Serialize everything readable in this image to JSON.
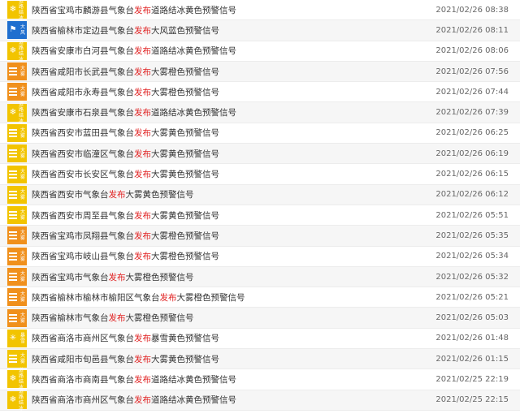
{
  "colors": {
    "yellow": "#f2c400",
    "orange": "#f0901c",
    "blue": "#1f6fcf",
    "highlight": "#e02020"
  },
  "items": [
    {
      "pre": "陕西省宝鸡市麟游县气象台",
      "hl": "发布",
      "post": "道路结冰黄色预警信号",
      "time": "2021/02/26 08:38",
      "icon": "road-icing-icon",
      "color": "yellow",
      "label": [
        "道路",
        "结冰"
      ]
    },
    {
      "pre": "陕西省榆林市定边县气象台",
      "hl": "发布",
      "post": "大风蓝色预警信号",
      "time": "2021/02/26 08:11",
      "icon": "gale-icon",
      "color": "blue",
      "label": [
        "大",
        "风"
      ]
    },
    {
      "pre": "陕西省安康市白河县气象台",
      "hl": "发布",
      "post": "道路结冰黄色预警信号",
      "time": "2021/02/26 08:06",
      "icon": "road-icing-icon",
      "color": "yellow",
      "label": [
        "道路",
        "结冰"
      ]
    },
    {
      "pre": "陕西省咸阳市长武县气象台",
      "hl": "发布",
      "post": "大雾橙色预警信号",
      "time": "2021/02/26 07:56",
      "icon": "fog-icon",
      "color": "orange",
      "label": [
        "大",
        "雾"
      ]
    },
    {
      "pre": "陕西省咸阳市永寿县气象台",
      "hl": "发布",
      "post": "大雾橙色预警信号",
      "time": "2021/02/26 07:44",
      "icon": "fog-icon",
      "color": "orange",
      "label": [
        "大",
        "雾"
      ]
    },
    {
      "pre": "陕西省安康市石泉县气象台",
      "hl": "发布",
      "post": "道路结冰黄色预警信号",
      "time": "2021/02/26 07:39",
      "icon": "road-icing-icon",
      "color": "yellow",
      "label": [
        "道路",
        "结冰"
      ]
    },
    {
      "pre": "陕西省西安市蓝田县气象台",
      "hl": "发布",
      "post": "大雾黄色预警信号",
      "time": "2021/02/26 06:25",
      "icon": "fog-icon",
      "color": "yellow",
      "label": [
        "大",
        "雾"
      ]
    },
    {
      "pre": "陕西省西安市临潼区气象台",
      "hl": "发布",
      "post": "大雾黄色预警信号",
      "time": "2021/02/26 06:19",
      "icon": "fog-icon",
      "color": "yellow",
      "label": [
        "大",
        "雾"
      ]
    },
    {
      "pre": "陕西省西安市长安区气象台",
      "hl": "发布",
      "post": "大雾黄色预警信号",
      "time": "2021/02/26 06:15",
      "icon": "fog-icon",
      "color": "yellow",
      "label": [
        "大",
        "雾"
      ]
    },
    {
      "pre": "陕西省西安市气象台",
      "hl": "发布",
      "post": "大雾黄色预警信号",
      "time": "2021/02/26 06:12",
      "icon": "fog-icon",
      "color": "yellow",
      "label": [
        "大",
        "雾"
      ]
    },
    {
      "pre": "陕西省西安市周至县气象台",
      "hl": "发布",
      "post": "大雾黄色预警信号",
      "time": "2021/02/26 05:51",
      "icon": "fog-icon",
      "color": "yellow",
      "label": [
        "大",
        "雾"
      ]
    },
    {
      "pre": "陕西省宝鸡市凤翔县气象台",
      "hl": "发布",
      "post": "大雾橙色预警信号",
      "time": "2021/02/26 05:35",
      "icon": "fog-icon",
      "color": "orange",
      "label": [
        "大",
        "雾"
      ]
    },
    {
      "pre": "陕西省宝鸡市岐山县气象台",
      "hl": "发布",
      "post": "大雾橙色预警信号",
      "time": "2021/02/26 05:34",
      "icon": "fog-icon",
      "color": "orange",
      "label": [
        "大",
        "雾"
      ]
    },
    {
      "pre": "陕西省宝鸡市气象台",
      "hl": "发布",
      "post": "大雾橙色预警信号",
      "time": "2021/02/26 05:32",
      "icon": "fog-icon",
      "color": "orange",
      "label": [
        "大",
        "雾"
      ]
    },
    {
      "pre": "陕西省榆林市榆林市榆阳区气象台",
      "hl": "发布",
      "post": "大雾橙色预警信号",
      "time": "2021/02/26 05:21",
      "icon": "fog-icon",
      "color": "orange",
      "label": [
        "大",
        "雾"
      ]
    },
    {
      "pre": "陕西省榆林市气象台",
      "hl": "发布",
      "post": "大雾橙色预警信号",
      "time": "2021/02/26 05:03",
      "icon": "fog-icon",
      "color": "orange",
      "label": [
        "大",
        "雾"
      ]
    },
    {
      "pre": "陕西省商洛市商州区气象台",
      "hl": "发布",
      "post": "暴雪黄色预警信号",
      "time": "2021/02/26 01:48",
      "icon": "snowstorm-icon",
      "color": "yellow",
      "label": [
        "暴",
        "雪"
      ]
    },
    {
      "pre": "陕西省咸阳市旬邑县气象台",
      "hl": "发布",
      "post": "大雾黄色预警信号",
      "time": "2021/02/26 01:15",
      "icon": "fog-icon",
      "color": "yellow",
      "label": [
        "大",
        "雾"
      ]
    },
    {
      "pre": "陕西省商洛市商南县气象台",
      "hl": "发布",
      "post": "道路结冰黄色预警信号",
      "time": "2021/02/25 22:19",
      "icon": "road-icing-icon",
      "color": "yellow",
      "label": [
        "道路",
        "结冰"
      ]
    },
    {
      "pre": "陕西省商洛市商州区气象台",
      "hl": "发布",
      "post": "道路结冰黄色预警信号",
      "time": "2021/02/25 22:15",
      "icon": "road-icing-icon",
      "color": "yellow",
      "label": [
        "道路",
        "结冰"
      ]
    }
  ]
}
